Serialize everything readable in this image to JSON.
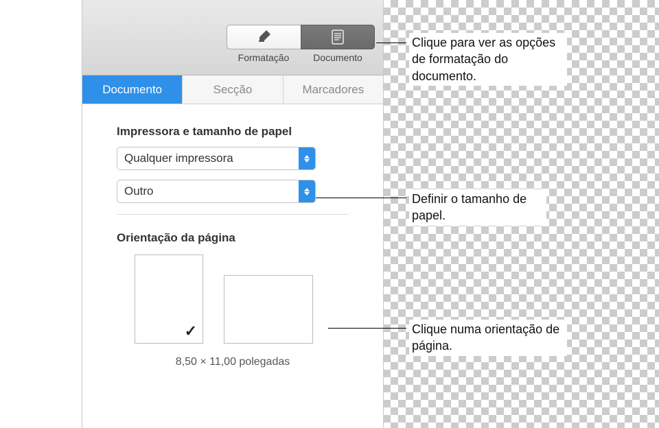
{
  "toolbar": {
    "format_label": "Formatação",
    "document_label": "Documento"
  },
  "tabs": {
    "document": "Documento",
    "section": "Secção",
    "bookmarks": "Marcadores"
  },
  "printer_section": {
    "title": "Impressora e tamanho de papel",
    "printer_value": "Qualquer impressora",
    "paper_value": "Outro"
  },
  "orientation_section": {
    "title": "Orientação da página",
    "dimensions": "8,50  ×  11,00 polegadas"
  },
  "callouts": {
    "doc_button": "Clique para ver as opções de formatação do documento.",
    "paper_size": "Definir o tamanho de papel.",
    "orientation": "Clique numa orientação de página."
  }
}
